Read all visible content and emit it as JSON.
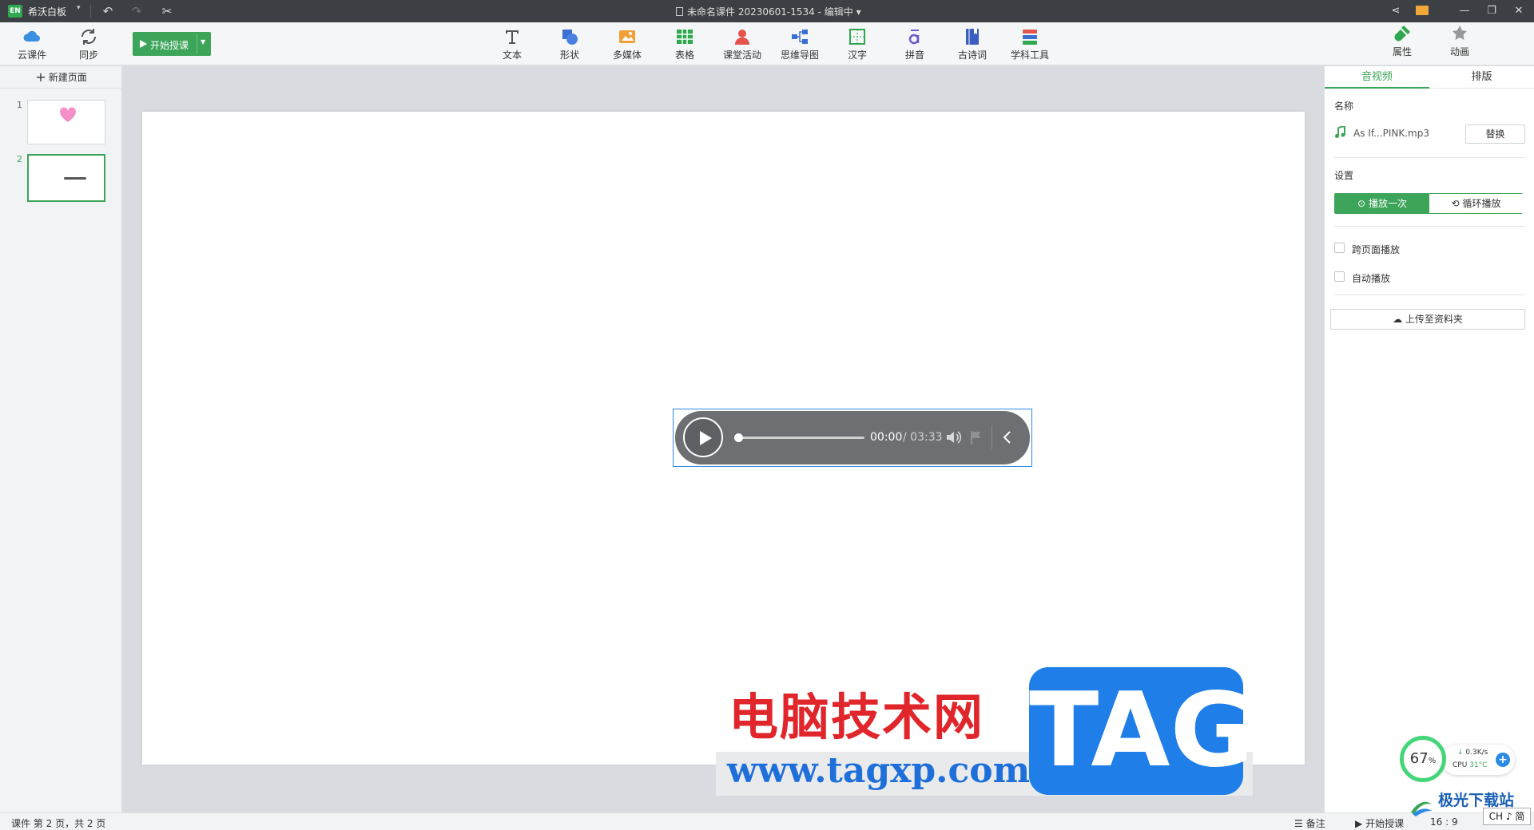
{
  "titlebar": {
    "logo_text": "EN",
    "app_name": "希沃白板",
    "document_title": "未命名课件 20230601-1534 - 编辑中",
    "icons": [
      "undo-icon",
      "redo-icon",
      "cut-icon",
      "share-icon",
      "mail-icon",
      "minimize-icon",
      "restore-icon",
      "close-icon"
    ]
  },
  "toolbar": {
    "left": [
      {
        "label": "云课件",
        "icon": "cloud-icon",
        "color": "#3b8fe0"
      },
      {
        "label": "同步",
        "icon": "sync-icon",
        "color": "#555555"
      }
    ],
    "start_label": "开始授课",
    "center": [
      {
        "label": "文本",
        "icon": "text-icon"
      },
      {
        "label": "形状",
        "icon": "shape-icon"
      },
      {
        "label": "多媒体",
        "icon": "media-icon"
      },
      {
        "label": "表格",
        "icon": "table-icon"
      },
      {
        "label": "课堂活动",
        "icon": "activity-icon"
      },
      {
        "label": "思维导图",
        "icon": "mindmap-icon"
      },
      {
        "label": "汉字",
        "icon": "hanzi-icon"
      },
      {
        "label": "拼音",
        "icon": "pinyin-icon"
      },
      {
        "label": "古诗词",
        "icon": "poetry-icon"
      },
      {
        "label": "学科工具",
        "icon": "subject-tools-icon"
      }
    ],
    "right": [
      {
        "label": "属性",
        "icon": "properties-icon"
      },
      {
        "label": "动画",
        "icon": "animation-icon"
      }
    ]
  },
  "left_panel": {
    "new_page_label": "新建页面",
    "pages": [
      {
        "number": "1"
      },
      {
        "number": "2",
        "active": true
      }
    ]
  },
  "audio_player": {
    "current_time": "00:00",
    "total_time": "/ 03:33",
    "progress": 0
  },
  "watermark": {
    "title": "电脑技术网",
    "url": "www.tagxp.com",
    "badge": "TAG",
    "secondary": "极光下载站"
  },
  "right_panel": {
    "tabs": [
      "音视频",
      "排版"
    ],
    "active_tab": 0,
    "name_label": "名称",
    "file_name": "As If...PINK.mp3",
    "replace_label": "替换",
    "settings_label": "设置",
    "play_once_label": "播放一次",
    "loop_label": "循环播放",
    "cross_page_label": "跨页面播放",
    "autoplay_label": "自动播放",
    "upload_label": "上传至资料夹"
  },
  "status_bar": {
    "page_info": "课件 第 2 页，共 2 页",
    "notes_label": "备注",
    "start_label": "开始授课",
    "ratio": "16 : 9"
  },
  "perf_widget": {
    "percent": "67",
    "percent_unit": "%",
    "net_speed": "0.3K/s",
    "cpu_label": "CPU",
    "cpu_temp": "31°C"
  },
  "ime": {
    "label": "CH ♪ 简"
  },
  "colors": {
    "accent": "#3da55a",
    "selection": "#2b8ae6",
    "titlebar": "#3c3f44"
  }
}
